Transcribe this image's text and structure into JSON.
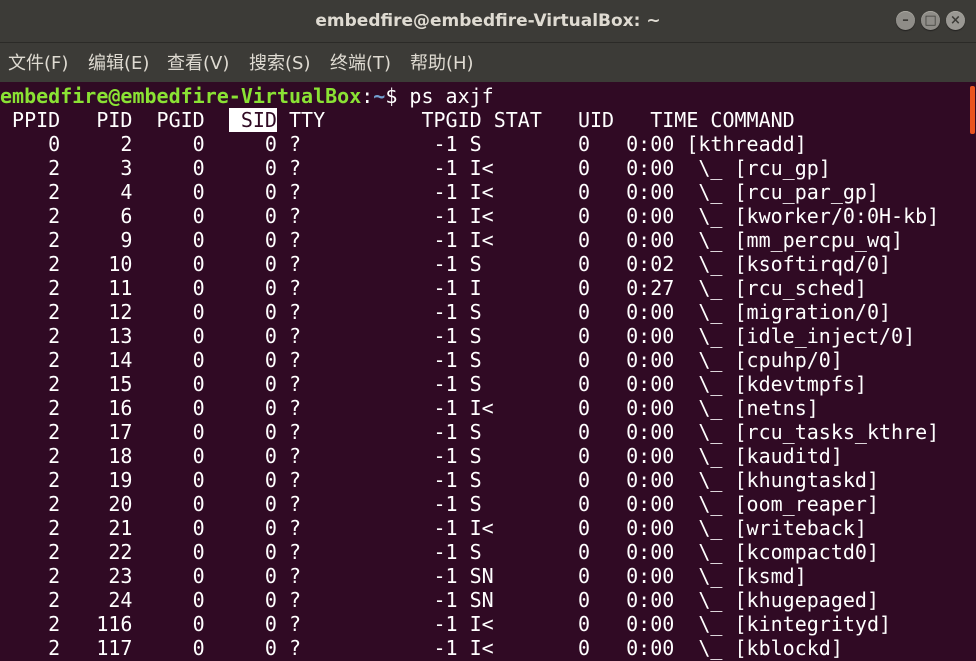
{
  "window": {
    "title": "embedfire@embedfire-VirtualBox: ~",
    "minimize_glyph": "–",
    "maximize_glyph": "□",
    "close_glyph": "×"
  },
  "menu": {
    "items": [
      {
        "label": "文件(F)"
      },
      {
        "label": "编辑(E)"
      },
      {
        "label": "查看(V)"
      },
      {
        "label": "搜索(S)"
      },
      {
        "label": "终端(T)"
      },
      {
        "label": "帮助(H)"
      }
    ]
  },
  "terminal": {
    "prompt_user": "embedfire@embedfire-VirtualBox",
    "prompt_sep": ":",
    "prompt_path": "~",
    "prompt_symbol": "$ ",
    "command": "ps axjf",
    "header_pre": " PPID   PID  PGID  ",
    "header_highlight": " SID",
    "header_post": " TTY        TPGID STAT   UID   TIME COMMAND",
    "rows": [
      "    0     2     0     0 ?           -1 S        0   0:00 [kthreadd]",
      "    2     3     0     0 ?           -1 I<       0   0:00  \\_ [rcu_gp]",
      "    2     4     0     0 ?           -1 I<       0   0:00  \\_ [rcu_par_gp]",
      "    2     6     0     0 ?           -1 I<       0   0:00  \\_ [kworker/0:0H-kb]",
      "    2     9     0     0 ?           -1 I<       0   0:00  \\_ [mm_percpu_wq]",
      "    2    10     0     0 ?           -1 S        0   0:02  \\_ [ksoftirqd/0]",
      "    2    11     0     0 ?           -1 I        0   0:27  \\_ [rcu_sched]",
      "    2    12     0     0 ?           -1 S        0   0:00  \\_ [migration/0]",
      "    2    13     0     0 ?           -1 S        0   0:00  \\_ [idle_inject/0]",
      "    2    14     0     0 ?           -1 S        0   0:00  \\_ [cpuhp/0]",
      "    2    15     0     0 ?           -1 S        0   0:00  \\_ [kdevtmpfs]",
      "    2    16     0     0 ?           -1 I<       0   0:00  \\_ [netns]",
      "    2    17     0     0 ?           -1 S        0   0:00  \\_ [rcu_tasks_kthre]",
      "    2    18     0     0 ?           -1 S        0   0:00  \\_ [kauditd]",
      "    2    19     0     0 ?           -1 S        0   0:00  \\_ [khungtaskd]",
      "    2    20     0     0 ?           -1 S        0   0:00  \\_ [oom_reaper]",
      "    2    21     0     0 ?           -1 I<       0   0:00  \\_ [writeback]",
      "    2    22     0     0 ?           -1 S        0   0:00  \\_ [kcompactd0]",
      "    2    23     0     0 ?           -1 SN       0   0:00  \\_ [ksmd]",
      "    2    24     0     0 ?           -1 SN       0   0:00  \\_ [khugepaged]",
      "    2   116     0     0 ?           -1 I<       0   0:00  \\_ [kintegrityd]",
      "    2   117     0     0 ?           -1 I<       0   0:00  \\_ [kblockd]"
    ]
  },
  "colors": {
    "terminal_bg": "#300a24",
    "prompt_user": "#8ae234",
    "prompt_path": "#729fcf",
    "titlebar_bg": "#3c3b37",
    "scrollbar": "#e95420"
  }
}
